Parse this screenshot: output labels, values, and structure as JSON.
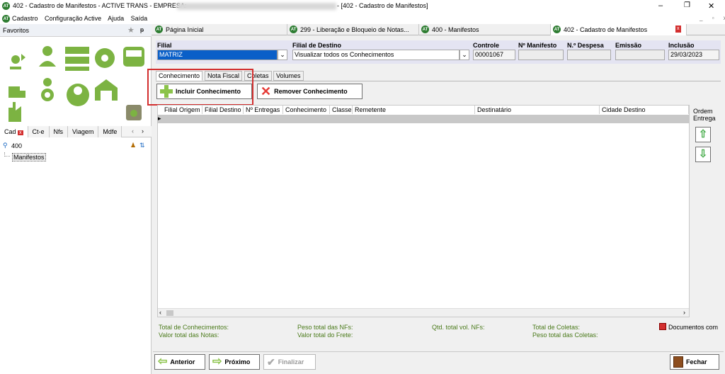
{
  "window": {
    "app_logo": "AT",
    "title": "402 - Cadastro de Manifestos - ACTIVE TRANS - EMPRESA:",
    "title_suffix": "- [402 - Cadastro de Manifestos]",
    "minimize": "–",
    "restore": "❐",
    "close": "✕",
    "mdi_minimize": "_",
    "mdi_restore": "▫",
    "mdi_close": "x"
  },
  "menu": {
    "items": [
      "Cadastro",
      "Configuração Active",
      "Ajuda",
      "Saída"
    ]
  },
  "sidebar": {
    "favoritos": "Favoritos",
    "pin": "ᵽ",
    "tabs": [
      "Cad",
      "Ct-e",
      "Nfs",
      "Viagem",
      "Mdfe"
    ],
    "search_value": "400",
    "tree_item": "Manifestos",
    "icons": [
      "add-route-icon",
      "user-icon",
      "fleet-icon",
      "tire-icon",
      "bus-icon",
      "truck-icon",
      "driver-icon",
      "operator-icon",
      "warehouse-icon",
      "factory-icon",
      "recycle-bin-icon"
    ]
  },
  "doc_tabs": [
    {
      "label": "Página Inicial"
    },
    {
      "label": "299 - Liberação e Bloqueio de Notas..."
    },
    {
      "label": "400 - Manifestos"
    },
    {
      "label": "402 - Cadastro de Manifestos"
    }
  ],
  "header": {
    "filial_label": "Filial",
    "filial_value": "MATRIZ",
    "destino_label": "Filial de Destino",
    "destino_value": "Visualizar todos os Conhecimentos",
    "controle_label": "Controle",
    "controle_value": "00001067",
    "manifesto_label": "Nº Manifesto",
    "despesa_label": "N.º Despesa",
    "emissao_label": "Emissão",
    "inclusao_label": "Inclusão",
    "inclusao_value": "29/03/2023"
  },
  "subtabs": [
    "Conhecimento",
    "Nota Fiscal",
    "Coletas",
    "Volumes"
  ],
  "actions": {
    "incluir": "Incluir Conhecimento",
    "remover": "Remover Conhecimento"
  },
  "grid": {
    "columns": [
      "Filial Origem",
      "Filial Destino",
      "Nº Entregas",
      "Conhecimento",
      "Classe",
      "Remetente",
      "Destinatário",
      "Cidade Destino"
    ],
    "ordem": "Ordem Entrega"
  },
  "summary": {
    "total_conhecimentos": "Total de Conhecimentos:",
    "valor_notas": "Valor total das Notas:",
    "peso_nfs": "Peso total das NFs:",
    "valor_frete": "Valor total do Frete:",
    "qtd_vol": "Qtd. total vol. NFs:",
    "total_coletas": "Total de Coletas:",
    "peso_coletas": "Peso total das Coletas:",
    "documentos": "Documentos com"
  },
  "footer": {
    "anterior": "Anterior",
    "proximo": "Próximo",
    "finalizar": "Finalizar",
    "fechar": "Fechar"
  },
  "colors": {
    "accent_green": "#7cb342",
    "header_bg": "#e4e4f2",
    "highlight_red": "#d32f2f",
    "selection_blue": "#0a5fc8"
  }
}
